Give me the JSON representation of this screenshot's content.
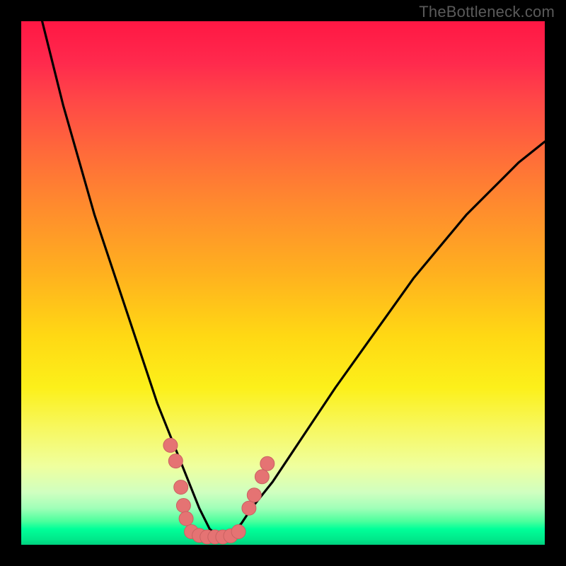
{
  "watermark": "TheBottleneck.com",
  "colors": {
    "curve": "#000000",
    "marker_fill": "#e57373",
    "marker_stroke": "#c96262",
    "frame": "#000000"
  },
  "chart_data": {
    "type": "line",
    "title": "",
    "xlabel": "",
    "ylabel": "",
    "xlim": [
      0,
      100
    ],
    "ylim": [
      0,
      100
    ],
    "note": "Values estimated from pixels: x is horizontal position (0 left, 100 right), y is bottleneck percentage (0 at green bottom, 100 at red top). Curve is V-shaped with minimum around x≈35.",
    "series": [
      {
        "name": "bottleneck-curve",
        "x": [
          4,
          6,
          8,
          10,
          12,
          14,
          16,
          18,
          20,
          22,
          24,
          26,
          28,
          30,
          32,
          34,
          36,
          38,
          40,
          42,
          44,
          48,
          52,
          56,
          60,
          65,
          70,
          75,
          80,
          85,
          90,
          95,
          100
        ],
        "y": [
          100,
          92,
          84,
          77,
          70,
          63,
          57,
          51,
          45,
          39,
          33,
          27,
          22,
          17,
          12,
          7,
          3,
          1.5,
          2,
          4,
          7,
          12,
          18,
          24,
          30,
          37,
          44,
          51,
          57,
          63,
          68,
          73,
          77
        ]
      }
    ],
    "markers": {
      "name": "highlighted-points",
      "points": [
        {
          "x": 28.5,
          "y": 19
        },
        {
          "x": 29.5,
          "y": 16
        },
        {
          "x": 30.5,
          "y": 11
        },
        {
          "x": 31,
          "y": 7.5
        },
        {
          "x": 31.5,
          "y": 5
        },
        {
          "x": 32.5,
          "y": 2.5
        },
        {
          "x": 34,
          "y": 1.8
        },
        {
          "x": 35.5,
          "y": 1.5
        },
        {
          "x": 37,
          "y": 1.5
        },
        {
          "x": 38.5,
          "y": 1.5
        },
        {
          "x": 40,
          "y": 1.7
        },
        {
          "x": 41.5,
          "y": 2.5
        },
        {
          "x": 43.5,
          "y": 7
        },
        {
          "x": 44.5,
          "y": 9.5
        },
        {
          "x": 46,
          "y": 13
        },
        {
          "x": 47,
          "y": 15.5
        }
      ],
      "radius": 10
    }
  }
}
